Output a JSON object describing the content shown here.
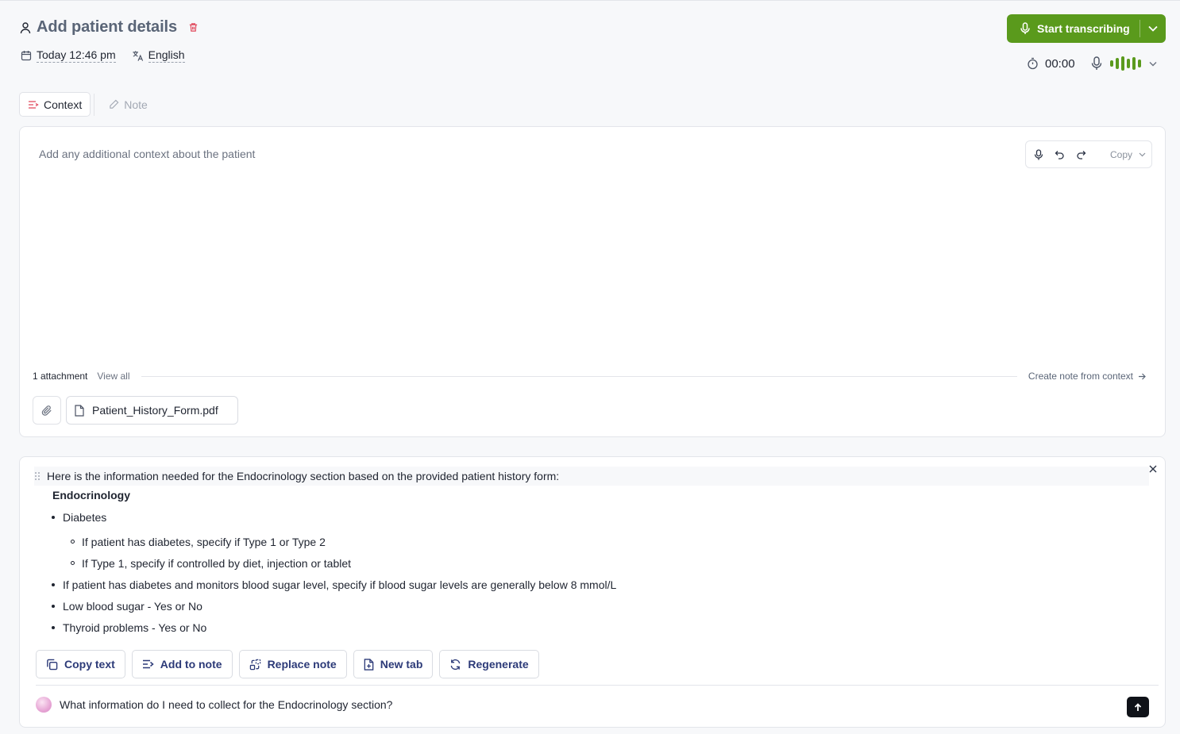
{
  "header": {
    "title": "Add patient details",
    "date": "Today 12:46 pm",
    "language": "English"
  },
  "record": {
    "start_label": "Start transcribing",
    "timer": "00:00",
    "accent": "#5a9a1c"
  },
  "tabs": [
    {
      "label": "Context",
      "active": true
    },
    {
      "label": "Note",
      "active": false
    }
  ],
  "context": {
    "placeholder": "Add any additional context about the patient",
    "copy_label": "Copy",
    "attachment_count": "1 attachment",
    "view_all": "View all",
    "create_note": "Create note from context",
    "file_name": "Patient_History_Form.pdf"
  },
  "answer": {
    "intro": "Here is the information needed for the Endocrinology section based on the provided patient history form:",
    "section_title": "Endocrinology",
    "items": [
      {
        "text": "Diabetes",
        "level": 1
      },
      {
        "text": "If patient has diabetes, specify if Type 1 or Type 2",
        "level": 2
      },
      {
        "text": "If Type 1, specify if controlled by diet, injection or tablet",
        "level": 2
      },
      {
        "text": "If patient has diabetes and monitors blood sugar level, specify if blood sugar levels are generally below 8 mmol/L",
        "level": 1
      },
      {
        "text": "Low blood sugar - Yes or No",
        "level": 1
      },
      {
        "text": "Thyroid problems - Yes or No",
        "level": 1
      }
    ],
    "actions": {
      "copy_text": "Copy text",
      "add_to_note": "Add to note",
      "replace_note": "Replace note",
      "new_tab": "New tab",
      "regenerate": "Regenerate"
    }
  },
  "chat": {
    "question": "What information do I need to collect for the Endocrinology section?"
  }
}
